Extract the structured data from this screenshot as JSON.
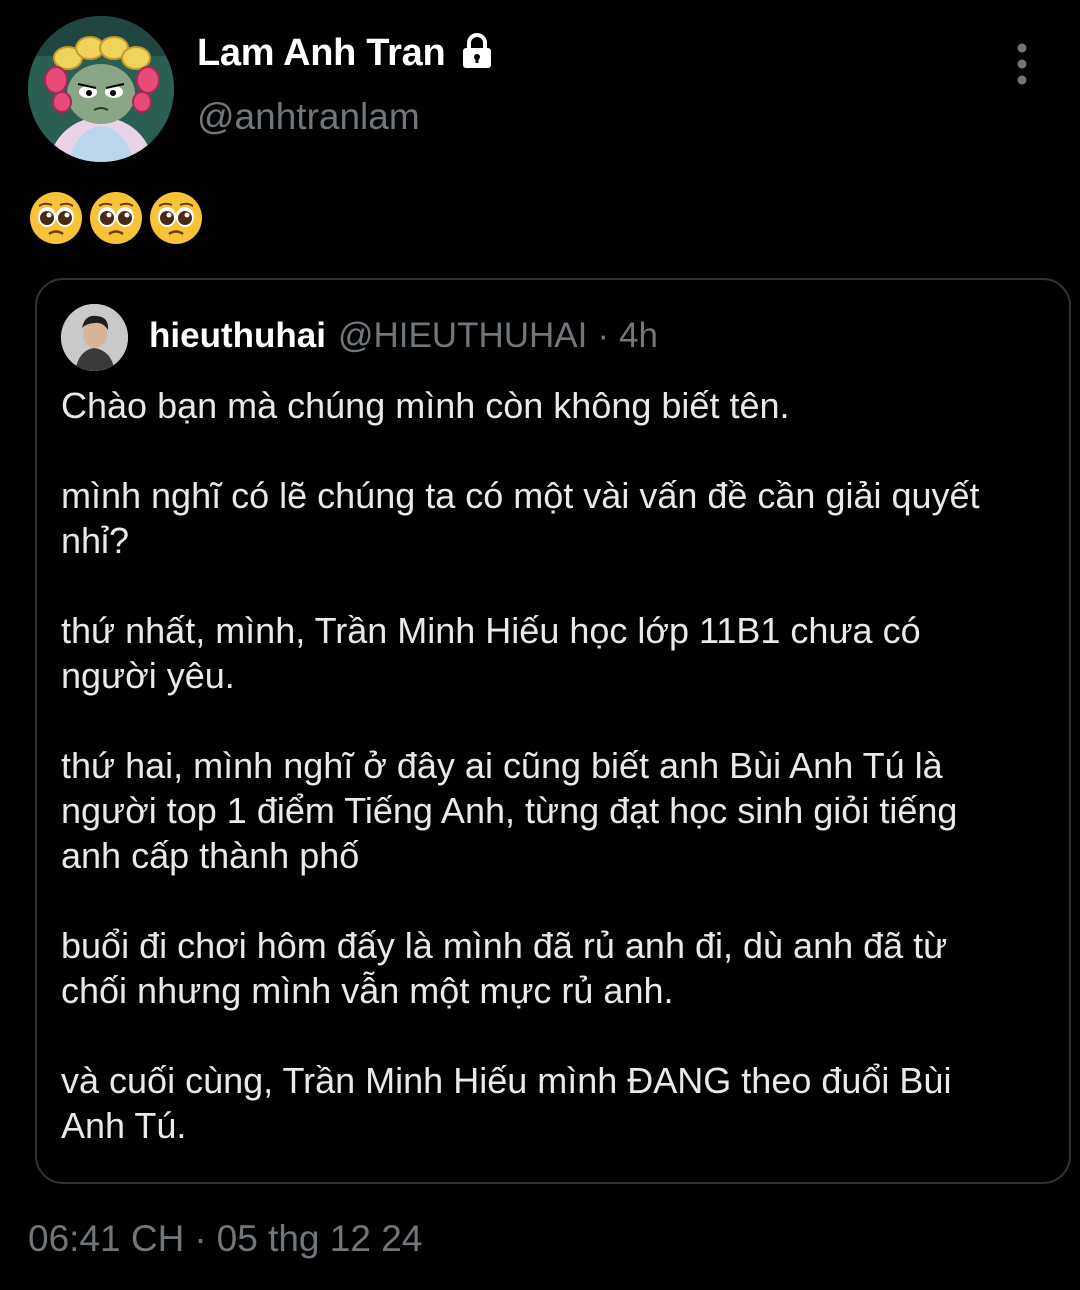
{
  "author": {
    "display_name": "Lam Anh Tran",
    "handle": "@anhtranlam",
    "protected_icon": "lock-icon",
    "avatar_icon": "cartoon-avatar"
  },
  "more_icon": "more-vertical-icon",
  "tweet_text_emoji": [
    "pleading-face",
    "pleading-face",
    "pleading-face"
  ],
  "quoted": {
    "display_name": "hieuthuhai",
    "handle": "@HIEUTHUHAI",
    "separator": "·",
    "time": "4h",
    "paragraphs": [
      "Chào bạn mà chúng mình còn không biết tên.",
      "mình nghĩ có lẽ chúng ta có một vài vấn đề cần giải quyết nhỉ?",
      "thứ nhất, mình, Trần Minh Hiếu học lớp 11B1 chưa có người yêu.",
      "thứ hai, mình nghĩ ở đây ai cũng biết anh Bùi Anh Tú là người top 1 điểm Tiếng Anh, từng đạt học sinh giỏi tiếng anh cấp thành phố",
      "buổi đi chơi hôm đấy là mình đã rủ anh đi, dù anh đã từ chối nhưng mình vẫn một mực rủ anh.",
      "và cuối cùng, Trần Minh Hiếu mình ĐANG theo đuổi Bùi Anh Tú."
    ]
  },
  "timestamp": {
    "time": "06:41 CH",
    "separator": "·",
    "date": "05 thg 12 24"
  },
  "colors": {
    "background": "#000000",
    "primary_text": "#e7e9ea",
    "secondary_text": "#71767b",
    "border": "#2f3336"
  }
}
